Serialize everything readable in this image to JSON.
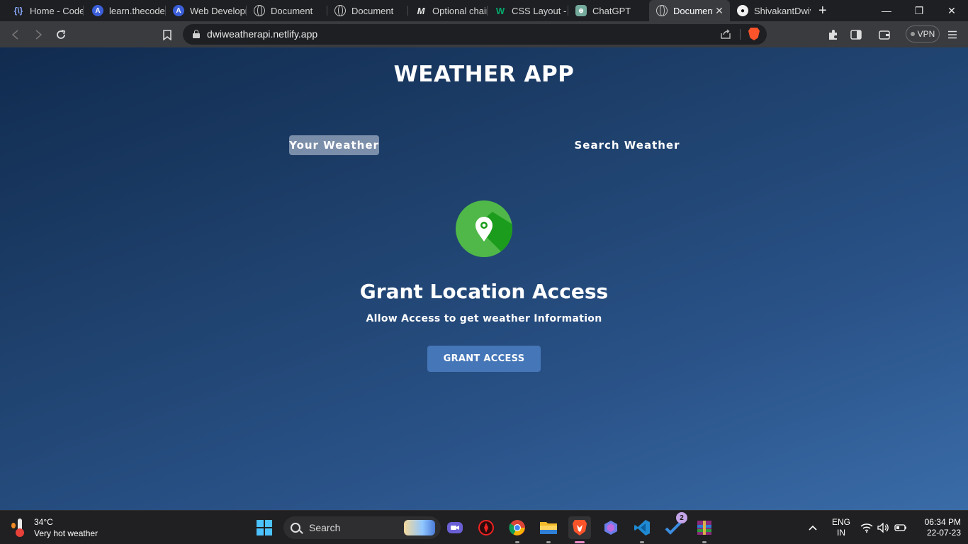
{
  "browser": {
    "tabs": [
      {
        "title": "Home - CodeHelp",
        "icon": "codehelp-icon"
      },
      {
        "title": "learn.thecodehelp.in",
        "icon": "codehelp-blue-icon"
      },
      {
        "title": "Web Development",
        "icon": "codehelp-blue-icon"
      },
      {
        "title": "Document",
        "icon": "globe-icon"
      },
      {
        "title": "Document",
        "icon": "globe-icon"
      },
      {
        "title": "Optional chaining",
        "icon": "mdn-icon"
      },
      {
        "title": "CSS Layout - The display",
        "icon": "w3schools-icon"
      },
      {
        "title": "ChatGPT",
        "icon": "chatgpt-icon"
      },
      {
        "title": "Document",
        "icon": "globe-icon",
        "active": true
      },
      {
        "title": "ShivakantDwivedi",
        "icon": "github-icon"
      }
    ],
    "fav_glyphs": {
      "codehelp": "{\\}",
      "mdn": "M",
      "w3": "W",
      "gpt": "⊛",
      "gh": "●"
    },
    "new_tab": "+",
    "window_controls": {
      "minimize": "—",
      "maximize": "❐",
      "close": "✕"
    },
    "tab_close": "✕",
    "url": "dwiweatherapi.netlify.app",
    "vpn_label": "VPN"
  },
  "app": {
    "title": "WEATHER APP",
    "tab_your_weather": "Your Weather",
    "tab_search_weather": "Search Weather",
    "grant_title": "Grant Location Access",
    "grant_subtitle": "Allow Access to get weather Information",
    "grant_button": "GRANT ACCESS",
    "icon_colors": {
      "circle": "#4fb848",
      "shadow": "#1c9c1c",
      "pin": "#ffffff"
    }
  },
  "taskbar": {
    "weather_temp": "34°C",
    "weather_desc": "Very hot weather",
    "search_placeholder": "Search",
    "todo_badge": "2",
    "language": "ENG",
    "region": "IN",
    "time": "06:34 PM",
    "date": "22-07-23"
  }
}
